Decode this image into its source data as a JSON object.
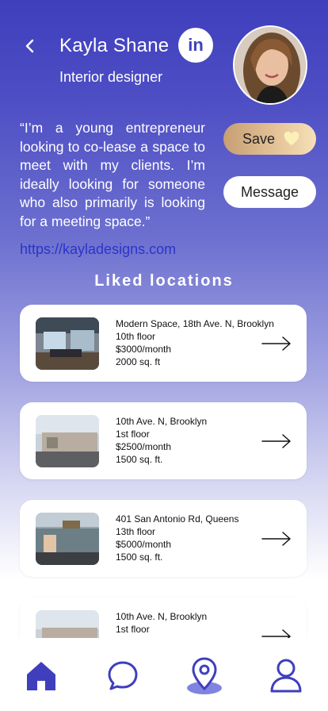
{
  "profile": {
    "name": "Kayla Shane",
    "role": "Interior designer",
    "linkedin_label": "in",
    "quote": "“I’m a young entrepreneur looking to co-lease a space to meet with my clients. I’m ideally looking for someone who also primarily is looking for a meeting space.”",
    "website": "https://kayladesigns.com"
  },
  "actions": {
    "save_label": "Save",
    "message_label": "Message"
  },
  "section": {
    "title": "Liked locations"
  },
  "locations": [
    {
      "address": "Modern Space, 18th Ave. N, Brooklyn",
      "floor": "10th floor",
      "price": "$3000/month",
      "size": "2000 sq. ft"
    },
    {
      "address": "10th Ave. N, Brooklyn",
      "floor": "1st floor",
      "price": "$2500/month",
      "size": "1500 sq. ft."
    },
    {
      "address": "401 San Antonio Rd,  Queens",
      "floor": "13th floor",
      "price": "$5000/month",
      "size": "1500 sq. ft."
    },
    {
      "address": "10th Ave. N, Brooklyn",
      "floor": "1st floor",
      "price": "",
      "size": ""
    }
  ],
  "nav": {
    "items": [
      "home-icon",
      "chat-icon",
      "location-pin-icon",
      "profile-icon"
    ],
    "accent": "#3f3fbd"
  },
  "colors": {
    "primary": "#3f3fbd",
    "link": "#2a35c9",
    "save_gradient_start": "#c79e73",
    "save_gradient_end": "#f5e0b8"
  }
}
